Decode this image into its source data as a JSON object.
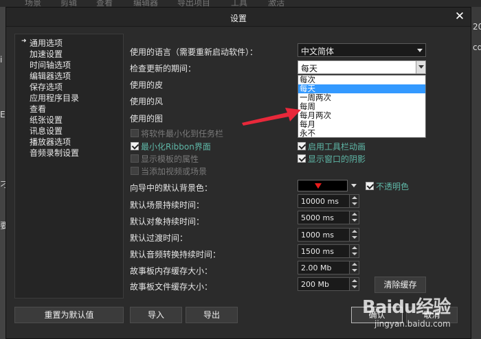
{
  "background": {
    "menu": [
      "场景",
      "剪辑",
      "查看",
      "编辑器",
      "导出项目",
      "工具",
      "激活"
    ],
    "right_edge": [
      "20",
      "cd"
    ],
    "left_edge": [
      "i",
      "E",
      "刁",
      "要"
    ]
  },
  "dialog": {
    "title": "设置",
    "close_symbol": "✕"
  },
  "nav": {
    "selected_marker": "➜",
    "items": [
      "通用选项",
      "加速设置",
      "时间轴选项",
      "编辑器选项",
      "保存选项",
      "应用程序目录",
      "查看",
      "纸张设置",
      "讯息设置",
      "播放器选项",
      "音频录制设置"
    ]
  },
  "settings": {
    "language_label": "使用的语言（需要重新启动软件）：",
    "language_value": "中文简体",
    "update_label": "检查更新的期间：",
    "update_value": "每天",
    "update_options": [
      "每次",
      "每天",
      "一周两次",
      "每周",
      "每月两次",
      "每月",
      "永不"
    ],
    "update_selected_index": 1,
    "skin_label": "使用的皮",
    "wind_label": "使用的风",
    "icon_label": "使用的图",
    "checks": [
      {
        "label": "将软件最小化到任务栏",
        "checked": false,
        "disabled": true
      },
      {
        "label": "最小化Ribbon界面",
        "checked": true,
        "disabled": false
      },
      {
        "label": "显示模板的属性",
        "checked": false,
        "disabled": true
      },
      {
        "label": "当添加视频或场景",
        "checked": false,
        "disabled": true
      },
      {
        "label": "启用工具栏动画",
        "checked": true,
        "disabled": false
      },
      {
        "label": "显示窗口的阴影",
        "checked": true,
        "disabled": false
      }
    ],
    "bg_color_label": "向导中的默认背景色：",
    "opaque_label": "不透明色",
    "opaque_checked": true,
    "durations": [
      {
        "label": "默认场景持续时间：",
        "value": "10000 ms"
      },
      {
        "label": "默认对象持续时间：",
        "value": "5000 ms"
      },
      {
        "label": "默认过渡时间：",
        "value": "1000 ms"
      },
      {
        "label": "默认音频转换持续时间：",
        "value": "1500 ms"
      },
      {
        "label": "故事板内存缓存大小：",
        "value": "2.00 Mb"
      },
      {
        "label": "故事板文件缓存大小：",
        "value": "200 Mb"
      }
    ],
    "clear_cache_label": "清除缓存"
  },
  "footer": {
    "reset_label": "重置为默认值",
    "import_label": "导入",
    "export_label": "导出",
    "ok_label": "确认",
    "cancel_label": "取消"
  },
  "watermark": {
    "logo": "Baidu经验",
    "url": "jingyan.baidu.com"
  },
  "colors": {
    "accent_teal": "#5fb8a8",
    "selection_blue": "#3399ff",
    "pointer_red": "#e8283a"
  }
}
